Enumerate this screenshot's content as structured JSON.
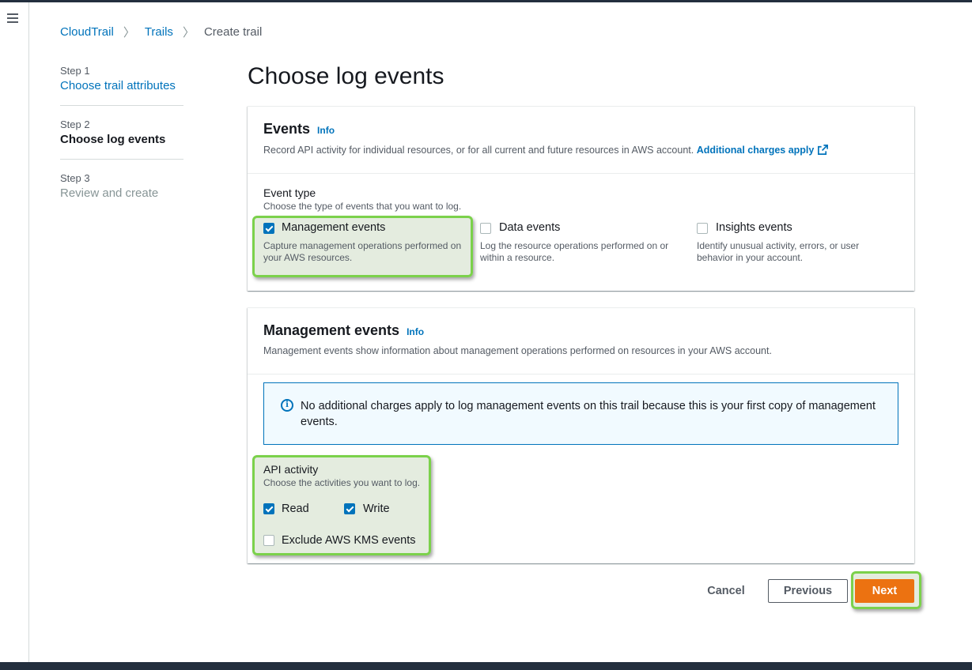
{
  "breadcrumb": {
    "items": [
      "CloudTrail",
      "Trails"
    ],
    "current": "Create trail"
  },
  "steps": [
    {
      "num": "Step 1",
      "title": "Choose trail attributes"
    },
    {
      "num": "Step 2",
      "title": "Choose log events"
    },
    {
      "num": "Step 3",
      "title": "Review and create"
    }
  ],
  "page_title": "Choose log events",
  "events_panel": {
    "title": "Events",
    "info": "Info",
    "desc": "Record API activity for individual resources, or for all current and future resources in AWS account.",
    "desc_link": "Additional charges apply",
    "event_type_label": "Event type",
    "event_type_desc": "Choose the type of events that you want to log.",
    "options": [
      {
        "label": "Management events",
        "desc": "Capture management operations performed on your AWS resources.",
        "checked": true
      },
      {
        "label": "Data events",
        "desc": "Log the resource operations performed on or within a resource.",
        "checked": false
      },
      {
        "label": "Insights events",
        "desc": "Identify unusual activity, errors, or user behavior in your account.",
        "checked": false
      }
    ]
  },
  "mgmt_panel": {
    "title": "Management events",
    "info": "Info",
    "desc": "Management events show information about management operations performed on resources in your AWS account.",
    "alert": "No additional charges apply to log management events on this trail because this is your first copy of management events.",
    "api_label": "API activity",
    "api_desc": "Choose the activities you want to log.",
    "read_label": "Read",
    "read_checked": true,
    "write_label": "Write",
    "write_checked": true,
    "exclude_label": "Exclude AWS KMS events",
    "exclude_checked": false
  },
  "actions": {
    "cancel": "Cancel",
    "previous": "Previous",
    "next": "Next"
  },
  "colors": {
    "link": "#0073bb",
    "primary_button": "#ec7211",
    "highlight_border": "#7bd14b",
    "nav_dark": "#232f3e"
  }
}
